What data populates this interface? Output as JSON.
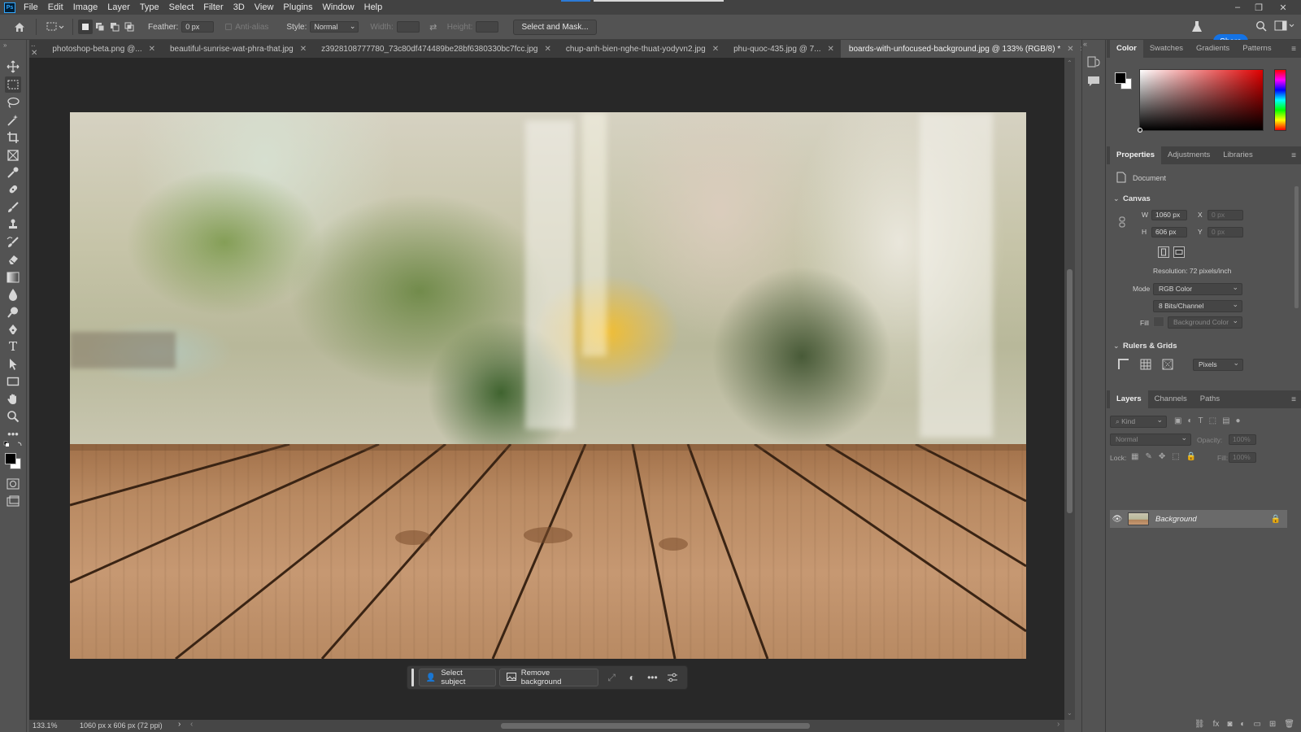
{
  "menubar": {
    "logo": "Ps",
    "items": [
      "File",
      "Edit",
      "Image",
      "Layer",
      "Type",
      "Select",
      "Filter",
      "3D",
      "View",
      "Plugins",
      "Window",
      "Help"
    ],
    "window_controls": [
      "–",
      "❐",
      "✕"
    ]
  },
  "options": {
    "feather_label": "Feather:",
    "feather_value": "0 px",
    "antialias_label": "Anti-alias",
    "style_label": "Style:",
    "style_value": "Normal",
    "width_label": "Width:",
    "height_label": "Height:",
    "select_mask_label": "Select and Mask...",
    "share_label": "Share"
  },
  "tabs": [
    {
      "label": "photoshop-beta.png @...",
      "active": false
    },
    {
      "label": "beautiful-sunrise-wat-phra-that.jpg",
      "active": false
    },
    {
      "label": "z3928108777780_73c80df474489be28bf6380330bc7fcc.jpg",
      "active": false
    },
    {
      "label": "chup-anh-bien-nghe-thuat-yodyvn2.jpg",
      "active": false
    },
    {
      "label": "phu-quoc-435.jpg @ 7...",
      "active": false
    },
    {
      "label": "boards-with-unfocused-background.jpg @ 133% (RGB/8) *",
      "active": true
    }
  ],
  "taskbar": {
    "select_subject": "Select subject",
    "remove_background": "Remove background"
  },
  "status": {
    "zoom": "133.1%",
    "doc_info": "1060 px x 606 px (72 ppi)"
  },
  "color_panel": {
    "tabs": [
      "Color",
      "Swatches",
      "Gradients",
      "Patterns"
    ]
  },
  "properties_panel": {
    "tabs": [
      "Properties",
      "Adjustments",
      "Libraries"
    ],
    "document_label": "Document",
    "canvas_header": "Canvas",
    "w_label": "W",
    "w_value": "1060 px",
    "h_label": "H",
    "h_value": "606 px",
    "x_label": "X",
    "x_value": "0 px",
    "y_label": "Y",
    "y_value": "0 px",
    "resolution": "Resolution: 72 pixels/inch",
    "mode_label": "Mode",
    "mode_value": "RGB Color",
    "bits_value": "8 Bits/Channel",
    "fill_label": "Fill",
    "fill_value": "Background Color",
    "rulers_header": "Rulers & Grids",
    "units_value": "Pixels"
  },
  "layers_panel": {
    "tabs": [
      "Layers",
      "Channels",
      "Paths"
    ],
    "kind_placeholder": "Kind",
    "blend_value": "Normal",
    "opacity_label": "Opacity:",
    "opacity_value": "100%",
    "lock_label": "Lock:",
    "fill_label": "Fill:",
    "fill_value": "100%",
    "layer_name": "Background"
  },
  "colors": {
    "accent": "#1473e6",
    "foreground": "#000000",
    "background": "#ffffff"
  }
}
